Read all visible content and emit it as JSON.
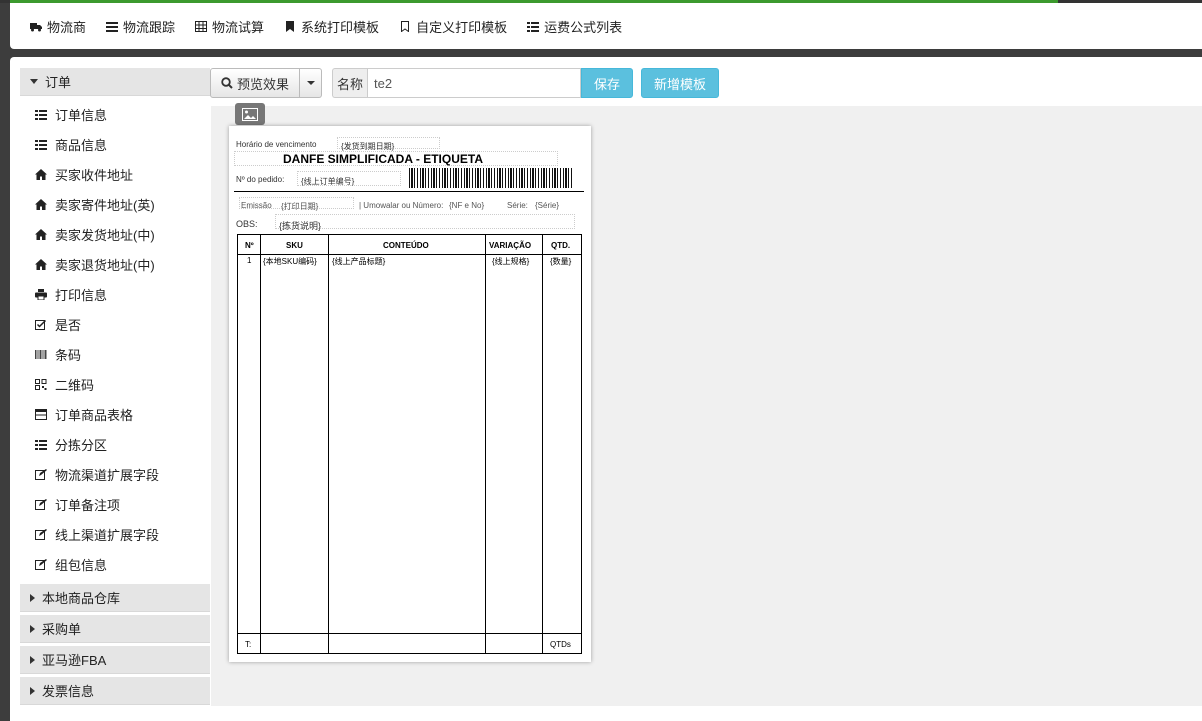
{
  "topnav": {
    "items": [
      {
        "label": "物流商",
        "icon": "truck-icon"
      },
      {
        "label": "物流跟踪",
        "icon": "tracking-icon"
      },
      {
        "label": "物流试算",
        "icon": "table-icon"
      },
      {
        "label": "系统打印模板",
        "icon": "bookmark-icon"
      },
      {
        "label": "自定义打印模板",
        "icon": "bookmark-outline-icon"
      },
      {
        "label": "运费公式列表",
        "icon": "list-icon"
      }
    ]
  },
  "sidebar": {
    "open_section": "订单",
    "items": [
      {
        "label": "订单信息",
        "icon": "list-icon"
      },
      {
        "label": "商品信息",
        "icon": "list-icon"
      },
      {
        "label": "买家收件地址",
        "icon": "home-icon"
      },
      {
        "label": "卖家寄件地址(英)",
        "icon": "home-icon"
      },
      {
        "label": "卖家发货地址(中)",
        "icon": "home-icon"
      },
      {
        "label": "卖家退货地址(中)",
        "icon": "home-icon"
      },
      {
        "label": "打印信息",
        "icon": "print-icon"
      },
      {
        "label": "是否",
        "icon": "checkbox-icon"
      },
      {
        "label": "条码",
        "icon": "barcode-icon"
      },
      {
        "label": "二维码",
        "icon": "qrcode-icon"
      },
      {
        "label": "订单商品表格",
        "icon": "table-icon"
      },
      {
        "label": "分拣分区",
        "icon": "list-icon"
      },
      {
        "label": "物流渠道扩展字段",
        "icon": "edit-icon"
      },
      {
        "label": "订单备注项",
        "icon": "edit-icon"
      },
      {
        "label": "线上渠道扩展字段",
        "icon": "edit-icon"
      },
      {
        "label": "组包信息",
        "icon": "edit-icon"
      }
    ],
    "sections": [
      "本地商品仓库",
      "采购单",
      "亚马逊FBA",
      "发票信息"
    ]
  },
  "toolbar": {
    "preview_label": "预览效果",
    "name_label": "名称",
    "name_value": "te2",
    "save_label": "保存",
    "new_label": "新增模板"
  },
  "label_template": {
    "due_label": "Horário de vencimento",
    "due_value": "{发货到期日期}",
    "title": "DANFE SIMPLIFICADA - ETIQUETA",
    "order_label": "Nº do pedido:",
    "order_value": "{线上订单编号}",
    "emission_label": "Emissão",
    "emission_value": "{打印日期}",
    "invoice_label": "| Umowalar ou Número:",
    "invoice_value": "{NF e No}",
    "series_label": "Série:",
    "series_value": "{Série}",
    "obs_label": "OBS:",
    "obs_value": "{拣货说明}",
    "columns": [
      "Nº",
      "SKU",
      "CONTEÚDO",
      "VARIAÇÃO",
      "QTD."
    ],
    "row": [
      "1",
      "{本地SKU编码}",
      "{线上产品标题}",
      "{线上规格}",
      "{数量}"
    ],
    "footer_left": "T:",
    "footer_right": "QTDs"
  }
}
